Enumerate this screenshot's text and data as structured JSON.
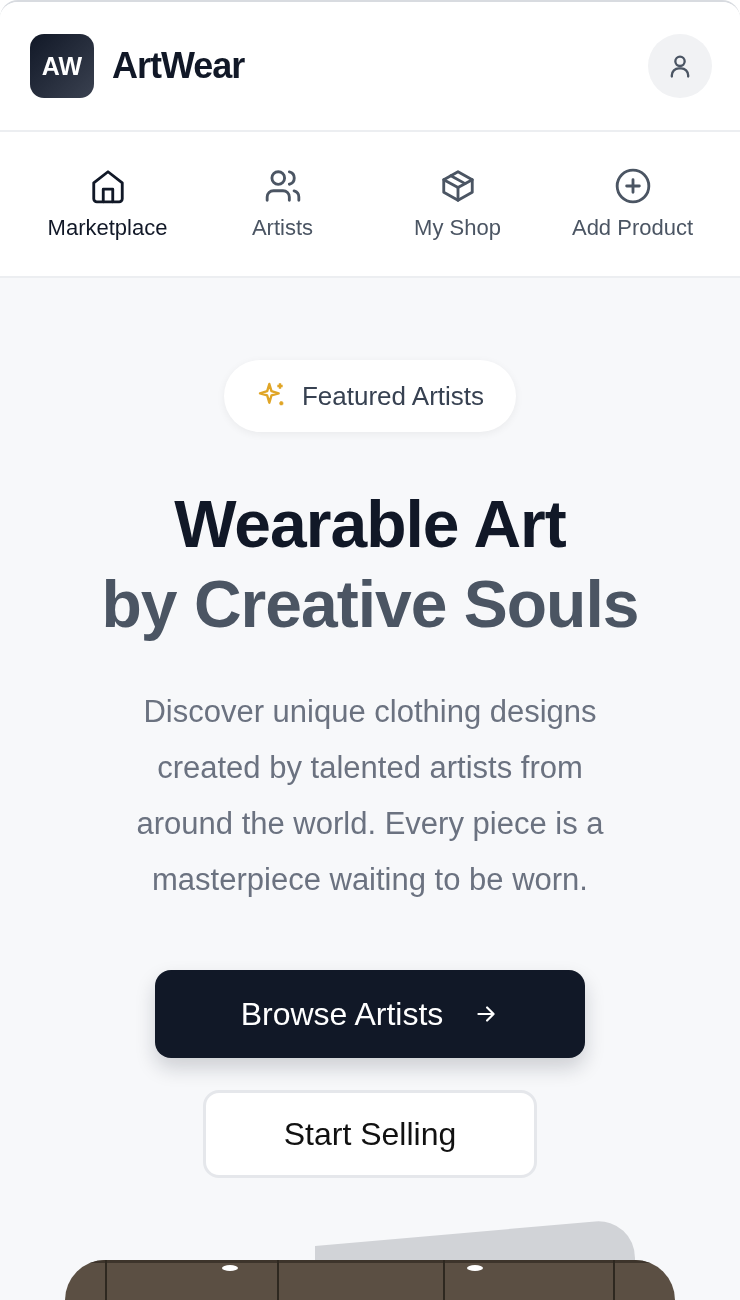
{
  "brand": {
    "logo": "AW",
    "name": "ArtWear"
  },
  "nav": [
    {
      "label": "Marketplace",
      "selected": true
    },
    {
      "label": "Artists",
      "selected": false
    },
    {
      "label": "My Shop",
      "selected": false
    },
    {
      "label": "Add Product",
      "selected": false
    }
  ],
  "badge": "Featured Artists",
  "headline": {
    "line_1": "Wearable Art",
    "line_2": "by Creative Souls"
  },
  "description": "Discover unique clothing designs created by talented artists from around the world. Every piece is a masterpiece waiting to be worn.",
  "buttons": [
    {
      "label": "Browse Artists",
      "kind": "primary"
    },
    {
      "label": "Start Selling",
      "kind": "secondary"
    }
  ]
}
